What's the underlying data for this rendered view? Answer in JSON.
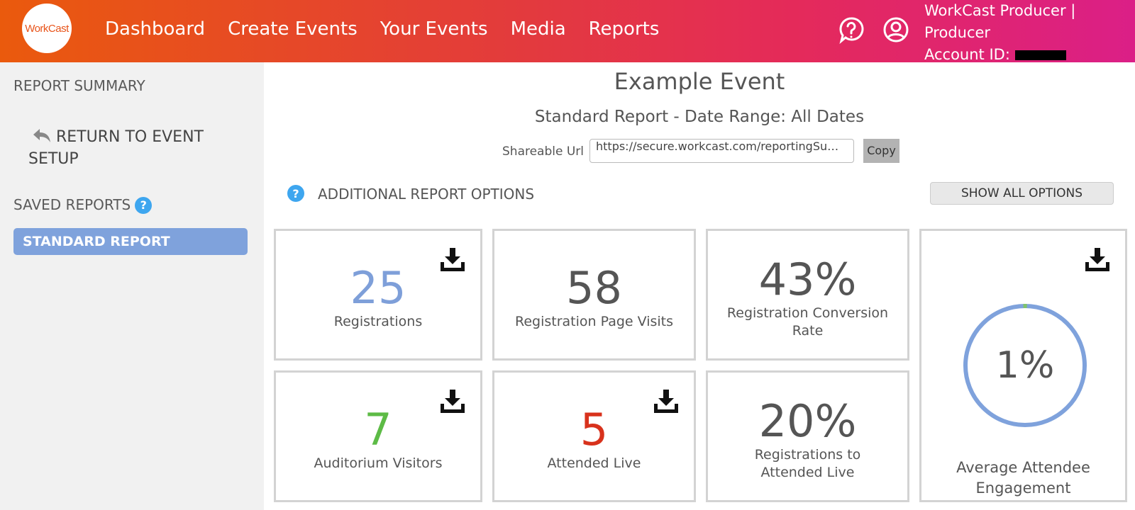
{
  "header": {
    "logo_text": "WorkCast",
    "nav": [
      "Dashboard",
      "Create Events",
      "Your Events",
      "Media",
      "Reports"
    ],
    "user_line1": "WorkCast Producer |",
    "user_line2": "Producer",
    "account_label": "Account ID:"
  },
  "sidebar": {
    "report_summary": "REPORT SUMMARY",
    "return_label": "RETURN TO EVENT SETUP",
    "saved_reports": "SAVED REPORTS",
    "saved_items": [
      "STANDARD REPORT"
    ]
  },
  "main": {
    "event_title": "Example Event",
    "report_subtitle": "Standard Report - Date Range: All Dates",
    "share_label": "Shareable Url",
    "share_url": "https://secure.workcast.com/reportingSummary.aspx",
    "copy_label": "Copy",
    "options_title": "ADDITIONAL REPORT OPTIONS",
    "show_all_label": "SHOW ALL OPTIONS"
  },
  "cards": {
    "registrations": {
      "value": "25",
      "label": "Registrations",
      "color": "#7e9fd9"
    },
    "page_visits": {
      "value": "58",
      "label": "Registration Page Visits",
      "color": "#555555"
    },
    "conversion": {
      "value": "43%",
      "label": "Registration Conversion Rate",
      "color": "#555555"
    },
    "auditorium": {
      "value": "7",
      "label": "Auditorium Visitors",
      "color": "#5dbb46"
    },
    "attended_live": {
      "value": "5",
      "label": "Attended Live",
      "color": "#d8321c"
    },
    "reg_to_attended": {
      "value": "20%",
      "label": "Registrations to Attended Live",
      "color": "#555555"
    },
    "engagement": {
      "value": "1%",
      "fraction": 0.01,
      "label": "Average Attendee Engagement",
      "ring_color": "#7fa2dc",
      "fill_color": "#7fc36a"
    }
  },
  "icons": {
    "download": "download-icon",
    "help": "help-circle-icon",
    "account": "account-circle-icon",
    "return": "return-arrow-icon"
  }
}
